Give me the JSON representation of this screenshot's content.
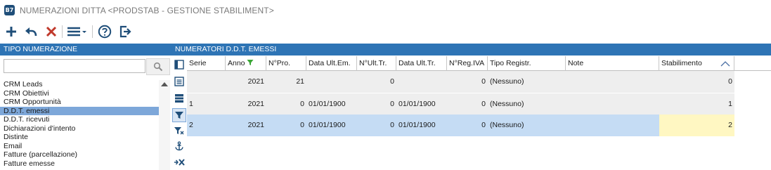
{
  "window": {
    "title": "NUMERAZIONI DITTA <PRODSTAB - GESTIONE STABILIMENT>",
    "icon_label": "B7"
  },
  "toolbar": {
    "buttons": [
      {
        "name": "add",
        "icon": "plus-icon"
      },
      {
        "name": "undo",
        "icon": "undo-arrow-icon"
      },
      {
        "name": "delete",
        "icon": "close-x-icon"
      },
      {
        "name": "menu",
        "icon": "hamburger-menu-icon"
      },
      {
        "name": "help",
        "icon": "help-question-icon"
      },
      {
        "name": "exit",
        "icon": "exit-door-icon"
      }
    ]
  },
  "left_panel": {
    "header": "TIPO NUMERAZIONE",
    "search_value": "",
    "items": [
      "CRM Leads",
      "CRM Obiettivi",
      "CRM Opportunità",
      "D.D.T. emessi",
      "D.D.T. ricevuti",
      "Dichiarazioni d'intento",
      "Distinte",
      "Email",
      "Fatture (parcellazione)",
      "Fatture emesse"
    ],
    "selected_index": 3
  },
  "right_panel": {
    "header": "NUMERATORI D.D.T. EMESSI",
    "columns": [
      "Serie",
      "Anno",
      "N°Pro.",
      "Data Ult.Em.",
      "N°Ult.Tr.",
      "Data Ult.Tr.",
      "N°Reg.IVA",
      "Tipo Registr.",
      "Note",
      "Stabilimento"
    ],
    "rows": [
      {
        "serie": "",
        "anno": "2021",
        "npro": "21",
        "data_ult_em": "",
        "nult_tr": "0",
        "data_ult_tr": "",
        "nreg_iva": "0",
        "tipo_registr": "(Nessuno)",
        "note": "",
        "stabilimento": "0"
      },
      {
        "serie": "1",
        "anno": "2021",
        "npro": "0",
        "data_ult_em": "01/01/1900",
        "nult_tr": "0",
        "data_ult_tr": "01/01/1900",
        "nreg_iva": "0",
        "tipo_registr": "(Nessuno)",
        "note": "",
        "stabilimento": "1"
      },
      {
        "serie": "2",
        "anno": "2021",
        "npro": "0",
        "data_ult_em": "01/01/1900",
        "nult_tr": "0",
        "data_ult_tr": "01/01/1900",
        "nreg_iva": "0",
        "tipo_registr": "(Nessuno)",
        "note": "",
        "stabilimento": "2"
      }
    ],
    "selected_row": 2,
    "active_cell": "stabilimento",
    "sort_column": "Stabilimento",
    "sort_direction": "ascending",
    "filtered_column": "Anno"
  },
  "colors": {
    "header_blue": "#2e74b5",
    "list_selected": "#7da7d9",
    "row_selected": "#c5dcf4",
    "row_alt": "#eeeeee",
    "active_cell": "#fff7c2",
    "delete_red": "#c0392b",
    "filter_green": "#3aa635"
  }
}
